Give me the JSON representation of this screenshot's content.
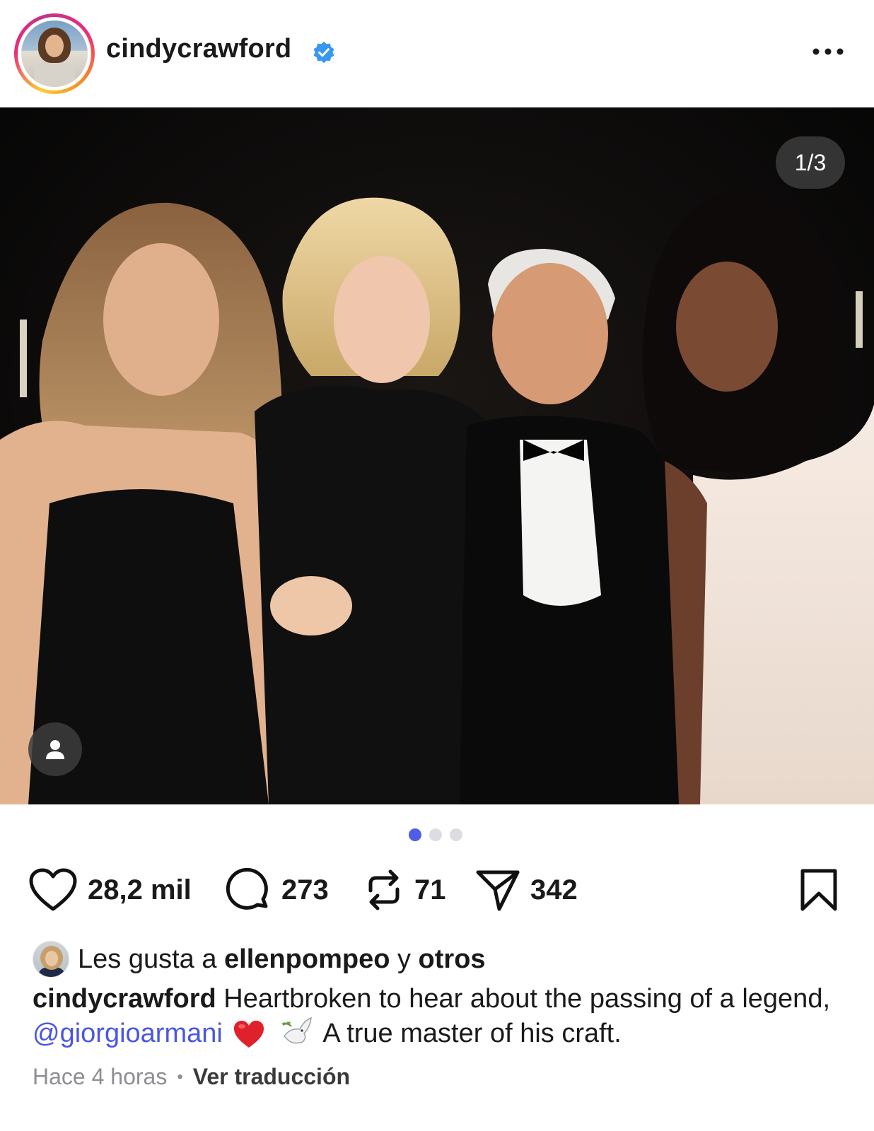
{
  "post": {
    "username": "cindycrawford",
    "verified": true,
    "more_icon": "more-horizontal-icon",
    "image_counter": "1/3",
    "carousel": {
      "total": 3,
      "active_index": 0
    },
    "actions": {
      "likes": "28,2 mil",
      "comments": "273",
      "reposts": "71",
      "shares": "342"
    },
    "liked_by": {
      "prefix": "Les gusta a",
      "user": "ellenpompeo",
      "joiner": "y",
      "others": "otros"
    },
    "caption": {
      "user": "cindycrawford",
      "text_1": "Heartbroken to hear about the passing of a legend,",
      "mention": "@giorgioarmani",
      "text_2": "A true master of his craft."
    },
    "timestamp": "Hace 4 horas",
    "translate_label": "Ver traducción",
    "colors": {
      "accent": "#4f5de8",
      "mention": "#4a56e2",
      "verified": "#3897f0",
      "muted": "#8e8e93"
    }
  }
}
